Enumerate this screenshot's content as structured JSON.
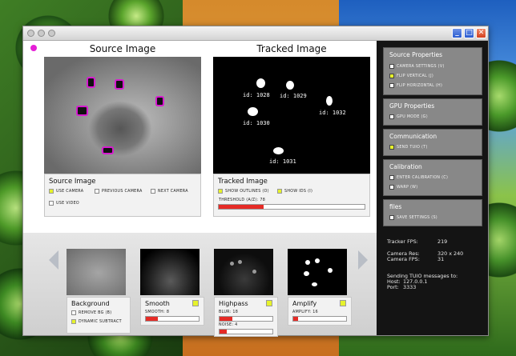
{
  "window": {
    "buttons": [
      "_",
      "□",
      "✕"
    ]
  },
  "source": {
    "title": "Source Image",
    "panel_title": "Source Image",
    "options": [
      {
        "label": "USE CAMERA",
        "checked": true
      },
      {
        "label": "PREVIOUS CAMERA",
        "checked": false
      },
      {
        "label": "NEXT CAMERA",
        "checked": false
      },
      {
        "label": "USE VIDEO",
        "checked": false
      }
    ]
  },
  "tracked": {
    "title": "Tracked Image",
    "panel_title": "Tracked Image",
    "options": [
      {
        "label": "SHOW OUTLINES (O)",
        "checked": true
      },
      {
        "label": "SHOW IDS (I)",
        "checked": true
      }
    ],
    "threshold_label": "THRESHOLD (A/Z): 78",
    "threshold_fraction": 0.31,
    "blob_ids": [
      "id: 1028",
      "id: 1029",
      "id: 1032",
      "id: 1030",
      "id: 1031"
    ]
  },
  "right_panel": {
    "source_props": {
      "title": "Source Properties",
      "options": [
        {
          "label": "CAMERA SETTINGS (V)",
          "checked": false
        },
        {
          "label": "FLIP VERTICAL (J)",
          "checked": true
        },
        {
          "label": "FLIP HORIZONTAL (H)",
          "checked": false
        }
      ]
    },
    "gpu": {
      "title": "GPU Properties",
      "options": [
        {
          "label": "GPU MODE (G)",
          "checked": false
        }
      ]
    },
    "communication": {
      "title": "Communication",
      "options": [
        {
          "label": "SEND TUIO (T)",
          "checked": true
        }
      ]
    },
    "calibration": {
      "title": "Calibration",
      "options": [
        {
          "label": "ENTER CALIBRATION (C)",
          "checked": false
        },
        {
          "label": "WARP (W)",
          "checked": false
        }
      ]
    },
    "files": {
      "title": "files",
      "options": [
        {
          "label": "SAVE SETTINGS (S)",
          "checked": false
        }
      ]
    }
  },
  "stats": {
    "tracker_fps_label": "Tracker FPS:",
    "tracker_fps": "219",
    "camera_res_label": "Camera Res:",
    "camera_res": "320 x 240",
    "camera_fps_label": "Camera FPS:",
    "camera_fps": "31",
    "tuio_line": "Sending TUIO messages to:",
    "host_label": "Host:",
    "host": "127.0.0.1",
    "port_label": "Port:",
    "port": "3333"
  },
  "filters": [
    {
      "title": "Background",
      "options": [
        {
          "label": "REMOVE BG (B)",
          "checked": false
        },
        {
          "label": "DYNAMIC SUBTRACT",
          "checked": true
        }
      ]
    },
    {
      "title": "Smooth",
      "slider_label": "SMOOTH: 8",
      "slider_fraction": 0.22
    },
    {
      "title": "Highpass",
      "slider_label": "BLUR: 18",
      "slider_fraction": 0.24,
      "slider2_label": "NOISE: 4",
      "slider2_fraction": 0.14
    },
    {
      "title": "Amplify",
      "slider_label": "AMPLIFY: 16",
      "slider_fraction": 0.09
    }
  ],
  "colors": {
    "accent_check": "#e6f22b",
    "slider_fill": "#e52b26",
    "outline": "#d61bd0"
  }
}
